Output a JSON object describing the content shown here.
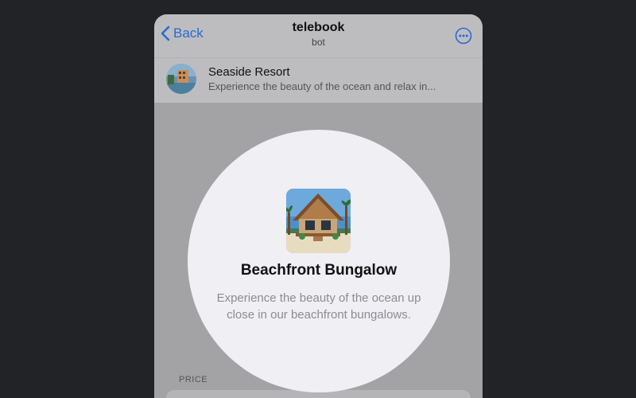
{
  "navbar": {
    "back_label": "Back",
    "title": "telebook",
    "subtitle": "bot"
  },
  "chat": {
    "name": "Seaside Resort",
    "description": "Experience the beauty of the ocean and relax in..."
  },
  "product": {
    "title": "Beachfront Bungalow",
    "description": "Experience the beauty of the ocean up close in our beachfront bungalows."
  },
  "form": {
    "price_label": "PRICE"
  },
  "colors": {
    "accent": "#2a6ad1",
    "background": "#222326",
    "overlay": "#a3a3a6",
    "spotlight": "#efeff4"
  },
  "icons": {
    "back": "chevron-left-icon",
    "more": "more-dots-icon"
  }
}
